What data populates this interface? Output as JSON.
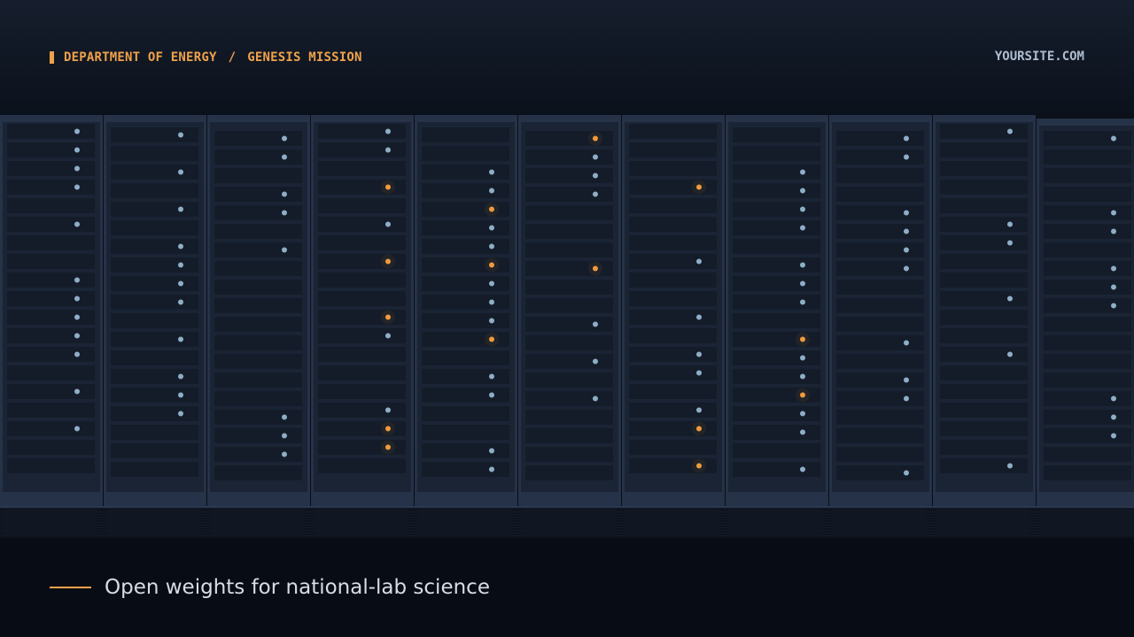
{
  "header": {
    "org": "DEPARTMENT OF ENERGY",
    "separator": "/",
    "mission": "GENESIS MISSION",
    "site": "YOURSITE.COM"
  },
  "footer": {
    "tagline": "Open weights for national-lab science"
  },
  "colors": {
    "accent": "#f0a24a",
    "site_text": "#aebdd0",
    "tagline_text": "#d6dde7",
    "rack_body": "#1a2434",
    "rack_frame": "#253247",
    "slot": "#141c29",
    "led_blue": "#8eaec6",
    "led_orange": "#ee9a3e"
  },
  "icons": {
    "brand_mark": "vertical-bar-icon",
    "tag_line": "horizontal-rule-icon",
    "rack_led": "status-led-icon"
  }
}
